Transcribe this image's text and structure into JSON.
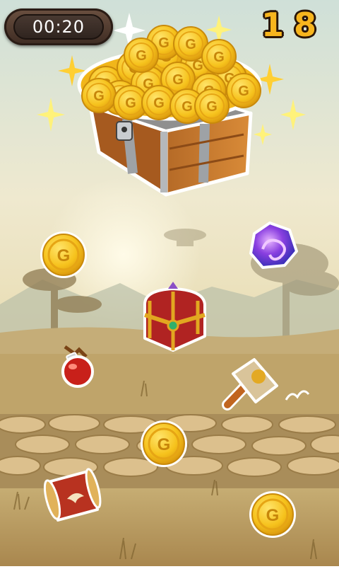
{
  "hud": {
    "timer": "00:20",
    "score": "18"
  },
  "coin_letter": "G",
  "icons": {
    "treasure_chest_large": "treasure-chest-gold-coins-icon",
    "coin": "gold-coin-icon",
    "orb": "purple-swirl-gem-icon",
    "jewel_chest": "jeweled-chest-icon",
    "potion": "red-potion-icon",
    "hammer": "hammer-icon",
    "scroll": "winged-scroll-icon",
    "sparkle": "sparkle-icon"
  },
  "colors": {
    "sky_top": "#f6ecd0",
    "sky_bottom": "#d9c79a",
    "ground": "#b99a62",
    "coin_gold": "#f6c21c",
    "score_gold": "#f7b51e"
  }
}
